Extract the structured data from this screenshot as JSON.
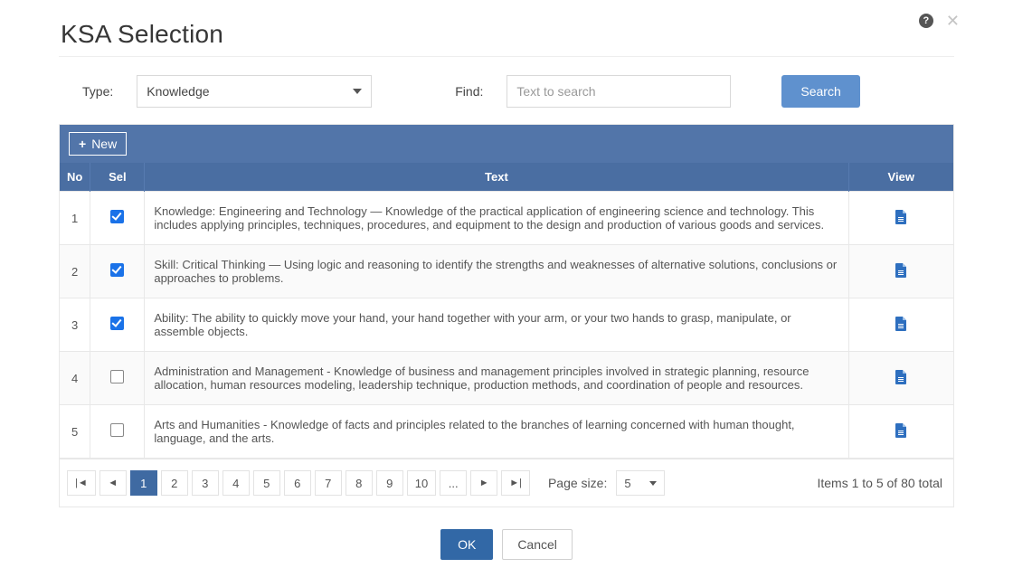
{
  "header": {
    "title": "KSA Selection"
  },
  "filters": {
    "type_label": "Type:",
    "type_value": "Knowledge",
    "find_label": "Find:",
    "find_placeholder": "Text to search",
    "search_label": "Search"
  },
  "toolbar": {
    "new_label": "New"
  },
  "columns": {
    "no": "No",
    "sel": "Sel",
    "text": "Text",
    "view": "View"
  },
  "rows": [
    {
      "no": "1",
      "selected": true,
      "text": "Knowledge: Engineering and Technology — Knowledge of the practical application of engineering science and technology. This includes applying principles, techniques, procedures, and equipment to the design and production of various goods and services."
    },
    {
      "no": "2",
      "selected": true,
      "text": "Skill: Critical Thinking — Using logic and reasoning to identify the strengths and weaknesses of alternative solutions, conclusions or approaches to problems."
    },
    {
      "no": "3",
      "selected": true,
      "text": "Ability: The ability to quickly move your hand, your hand together with your arm, or your two hands to grasp, manipulate, or assemble objects."
    },
    {
      "no": "4",
      "selected": false,
      "text": "Administration and Management - Knowledge of business and management principles involved in strategic planning, resource allocation, human resources modeling, leadership technique, production methods, and coordination of people and resources."
    },
    {
      "no": "5",
      "selected": false,
      "text": "Arts and Humanities - Knowledge of facts and principles related to the branches of learning concerned with human thought, language, and the arts."
    }
  ],
  "pagination": {
    "pages": [
      "1",
      "2",
      "3",
      "4",
      "5",
      "6",
      "7",
      "8",
      "9",
      "10",
      "..."
    ],
    "current": "1",
    "page_size_label": "Page size:",
    "page_size_value": "5",
    "summary": "Items 1 to 5 of 80 total"
  },
  "footer": {
    "ok": "OK",
    "cancel": "Cancel"
  },
  "colors": {
    "primary": "#5275a9",
    "primary_dark": "#3f6aa2",
    "accent_blue": "#1a72e8"
  }
}
